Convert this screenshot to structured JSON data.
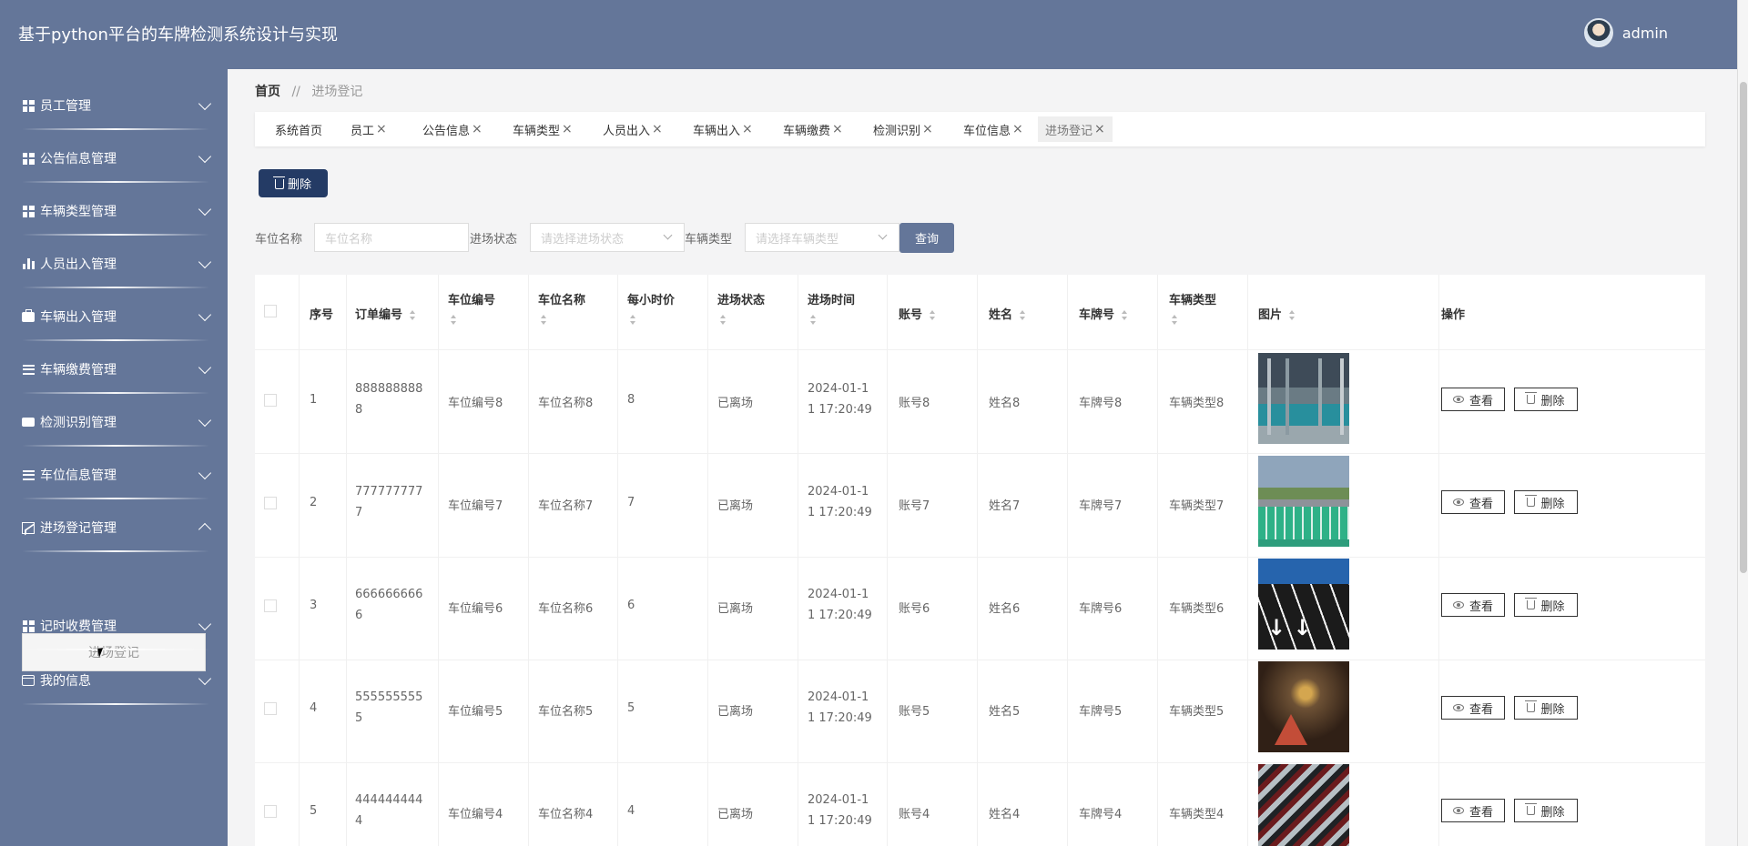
{
  "header": {
    "title": "基于python平台的车牌检测系统设计与实现",
    "user_name": "admin"
  },
  "sidebar": {
    "items": [
      {
        "label": "员工管理",
        "icon": "grid-icon"
      },
      {
        "label": "公告信息管理",
        "icon": "grid-icon"
      },
      {
        "label": "车辆类型管理",
        "icon": "grid-icon"
      },
      {
        "label": "人员出入管理",
        "icon": "bar-chart-icon"
      },
      {
        "label": "车辆出入管理",
        "icon": "briefcase-icon"
      },
      {
        "label": "车辆缴费管理",
        "icon": "list-icon"
      },
      {
        "label": "检测识别管理",
        "icon": "ticket-icon"
      },
      {
        "label": "车位信息管理",
        "icon": "list-icon"
      },
      {
        "label": "进场登记管理",
        "icon": "line-chart-icon"
      },
      {
        "label": "记时收费管理",
        "icon": "grid-icon"
      },
      {
        "label": "我的信息",
        "icon": "card-icon"
      }
    ],
    "submenu_item": "进场登记"
  },
  "breadcrumb": {
    "home": "首页",
    "separator": "//",
    "current": "进场登记"
  },
  "tabs": [
    {
      "label": "系统首页",
      "closable": false
    },
    {
      "label": "员工",
      "closable": true
    },
    {
      "label": "公告信息",
      "closable": true
    },
    {
      "label": "车辆类型",
      "closable": true
    },
    {
      "label": "人员出入",
      "closable": true
    },
    {
      "label": "车辆出入",
      "closable": true
    },
    {
      "label": "车辆缴费",
      "closable": true
    },
    {
      "label": "检测识别",
      "closable": true
    },
    {
      "label": "车位信息",
      "closable": true
    },
    {
      "label": "进场登记",
      "closable": true,
      "active": true
    }
  ],
  "tab_close_symbol": "×",
  "toolbar": {
    "delete_label": "删除"
  },
  "search": {
    "space_name_label": "车位名称",
    "space_name_placeholder": "车位名称",
    "entry_status_label": "进场状态",
    "entry_status_placeholder": "请选择进场状态",
    "vehicle_type_label": "车辆类型",
    "vehicle_type_placeholder": "请选择车辆类型",
    "query_label": "查询"
  },
  "table": {
    "headers": {
      "index": "序号",
      "order_no": "订单编号",
      "space_no": "车位编号",
      "space_name": "车位名称",
      "hourly_price": "每小时价",
      "entry_status": "进场状态",
      "entry_time": "进场时间",
      "account": "账号",
      "name": "姓名",
      "plate": "车牌号",
      "vehicle_type": "车辆类型",
      "image": "图片",
      "actions": "操作"
    },
    "rows": [
      {
        "index": "1",
        "order_no_l1": "888888888",
        "order_no_l2": "8",
        "space_no": "车位编号8",
        "space_name": "车位名称8",
        "hourly_price": "8",
        "entry_status": "已离场",
        "entry_time_l1": "2024-01-1",
        "entry_time_l2": "1 17:20:49",
        "account": "账号8",
        "name": "姓名8",
        "plate": "车牌号8",
        "vehicle_type": "车辆类型8",
        "image": "parking-garage-image"
      },
      {
        "index": "2",
        "order_no_l1": "777777777",
        "order_no_l2": "7",
        "space_no": "车位编号7",
        "space_name": "车位名称7",
        "hourly_price": "7",
        "entry_status": "已离场",
        "entry_time_l1": "2024-01-1",
        "entry_time_l2": "1 17:20:49",
        "account": "账号7",
        "name": "姓名7",
        "plate": "车牌号7",
        "vehicle_type": "车辆类型7",
        "image": "grass-parking-image"
      },
      {
        "index": "3",
        "order_no_l1": "666666666",
        "order_no_l2": "6",
        "space_no": "车位编号6",
        "space_name": "车位名称6",
        "hourly_price": "6",
        "entry_status": "已离场",
        "entry_time_l1": "2024-01-1",
        "entry_time_l2": "1 17:20:49",
        "account": "账号6",
        "name": "姓名6",
        "plate": "车牌号6",
        "vehicle_type": "车辆类型6",
        "image": "road-parking-image"
      },
      {
        "index": "4",
        "order_no_l1": "555555555",
        "order_no_l2": "5",
        "space_no": "车位编号5",
        "space_name": "车位名称5",
        "hourly_price": "5",
        "entry_status": "已离场",
        "entry_time_l1": "2024-01-1",
        "entry_time_l2": "1 17:20:49",
        "account": "账号5",
        "name": "姓名5",
        "plate": "车牌号5",
        "vehicle_type": "车辆类型5",
        "image": "underground-lot-image"
      },
      {
        "index": "5",
        "order_no_l1": "444444444",
        "order_no_l2": "4",
        "space_no": "车位编号4",
        "space_name": "车位名称4",
        "hourly_price": "4",
        "entry_status": "已离场",
        "entry_time_l1": "2024-01-1",
        "entry_time_l2": "1 17:20:49",
        "account": "账号4",
        "name": "姓名4",
        "plate": "车牌号4",
        "vehicle_type": "车辆类型4",
        "image": "many-cars-image"
      }
    ],
    "view_label": "查看",
    "delete_label": "删除"
  }
}
